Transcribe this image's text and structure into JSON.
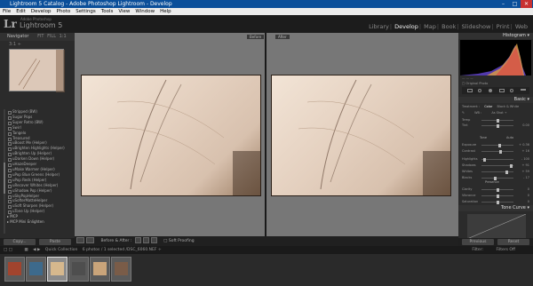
{
  "window": {
    "title": "Lightroom 5 Catalog - Adobe Photoshop Lightroom - Develop"
  },
  "menu": [
    "File",
    "Edit",
    "Develop",
    "Photo",
    "Settings",
    "Tools",
    "View",
    "Window",
    "Help"
  ],
  "identity": {
    "logo": "Lr",
    "subtitle": "Adobe Photoshop",
    "app": "Lightroom 5"
  },
  "modules": [
    "Library",
    "Develop",
    "Map",
    "Book",
    "Slideshow",
    "Print",
    "Web"
  ],
  "navigator": {
    "title": "Navigator",
    "fit": "FIT",
    "fill": "FILL",
    "zoom1": "1:1",
    "zoom2": "3:1 ÷"
  },
  "presets": [
    "Stripped (BW)",
    "Sugar Pops",
    "Super Retro (BW)",
    "Swirl",
    "Tangelo",
    "Treasured",
    "uBoost Me (Helper)",
    "uBrighten Highlights (Helper)",
    "uBrighten Up (Helper)",
    "uDarken Down (Helper)",
    "uHazeDeeper",
    "uMake Warmer (Helper)",
    "uPop Blue Greens (Helper)",
    "uPop Reds (Helper)",
    "uRecover Whites (Helper)",
    "uShadow Pop (Helper)",
    "uSkyPopHelper",
    "uSofterMatteHelper",
    "uSoft Sharpen (Helper)",
    "uTone Up (Helper)"
  ],
  "folders": [
    "MCP",
    "MCP Mini Enlighten"
  ],
  "left_buttons": {
    "copy": "Copy...",
    "paste": "Paste"
  },
  "view": {
    "before": "Before",
    "after": "After"
  },
  "toolbar": {
    "label": "Before & After :",
    "soft": "Soft Proofing"
  },
  "right": {
    "histogram": "Histogram",
    "readout": "—   —   —",
    "original": "Original Photo",
    "basic": "Basic",
    "treatment": "Treatment :",
    "color": "Color",
    "bw": "Black & White",
    "wb": "WB :",
    "wb_value": "As Shot ÷",
    "tone": "Tone",
    "auto": "Auto",
    "presence": "Presence",
    "tone_curve": "Tone Curve",
    "previous": "Previous",
    "reset": "Reset"
  },
  "sliders": [
    {
      "label": "Temp",
      "val": "",
      "pos": 0.5
    },
    {
      "label": "Tint",
      "val": "0.00",
      "pos": 0.5
    },
    {
      "label": "Exposure",
      "val": "+ 0.36",
      "pos": 0.55
    },
    {
      "label": "Contrast",
      "val": "+ 16",
      "pos": 0.6
    },
    {
      "label": "Highlights",
      "val": "- 100",
      "pos": 0.05
    },
    {
      "label": "Shadows",
      "val": "+ 91",
      "pos": 0.95
    },
    {
      "label": "Whites",
      "val": "+ 59",
      "pos": 0.8
    },
    {
      "label": "Blacks",
      "val": "- 17",
      "pos": 0.4
    },
    {
      "label": "Clarity",
      "val": "0",
      "pos": 0.5
    },
    {
      "label": "Vibrance",
      "val": "0",
      "pos": 0.5
    },
    {
      "label": "Saturation",
      "val": "0",
      "pos": 0.5
    }
  ],
  "filmbar": {
    "collection": "Quick Collection",
    "info": "6 photos / 1 selected /DSC_6060.NEF ÷",
    "filter": "Filter:",
    "filter_value": "Filters Off"
  },
  "thumb_colors": [
    "#a1442e",
    "#3d6a8c",
    "#d6b88d",
    "#4e4e4e",
    "#c9a47a",
    "#7a5c48"
  ]
}
